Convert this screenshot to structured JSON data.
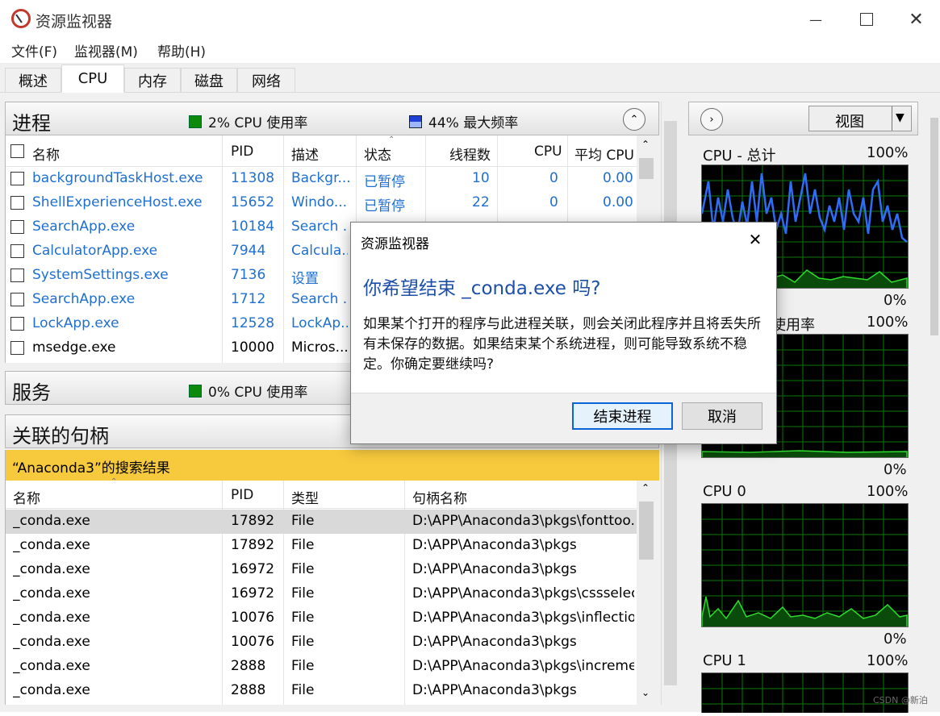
{
  "window": {
    "title": "资源监视器"
  },
  "menu": [
    "文件(F)",
    "监视器(M)",
    "帮助(H)"
  ],
  "tabs": [
    "概述",
    "CPU",
    "内存",
    "磁盘",
    "网络"
  ],
  "active_tab": "CPU",
  "processes": {
    "title": "进程",
    "cpu_usage": "2% CPU 使用率",
    "max_freq": "44% 最大频率",
    "columns": [
      "名称",
      "PID",
      "描述",
      "状态",
      "线程数",
      "CPU",
      "平均 CPU"
    ],
    "rows": [
      {
        "name": "backgroundTaskHost.exe",
        "pid": "11308",
        "desc": "Backgr...",
        "status": "已暂停",
        "threads": "10",
        "cpu": "0",
        "avg": "0.00"
      },
      {
        "name": "ShellExperienceHost.exe",
        "pid": "15652",
        "desc": "Windo...",
        "status": "已暂停",
        "threads": "22",
        "cpu": "0",
        "avg": "0.00"
      },
      {
        "name": "SearchApp.exe",
        "pid": "10184",
        "desc": "Search ..."
      },
      {
        "name": "CalculatorApp.exe",
        "pid": "7944",
        "desc": "Calcula..."
      },
      {
        "name": "SystemSettings.exe",
        "pid": "7136",
        "desc": "设置"
      },
      {
        "name": "SearchApp.exe",
        "pid": "1712",
        "desc": "Search ..."
      },
      {
        "name": "LockApp.exe",
        "pid": "12528",
        "desc": "LockAp..."
      },
      {
        "name": "msedge.exe",
        "pid": "10000",
        "desc": "Micros..."
      }
    ]
  },
  "services": {
    "title": "服务",
    "cpu_usage": "0% CPU 使用率"
  },
  "handles": {
    "title": "关联的句柄",
    "search_result": "“Anaconda3”的搜索结果",
    "columns": [
      "名称",
      "PID",
      "类型",
      "句柄名称"
    ],
    "rows": [
      {
        "name": "_conda.exe",
        "pid": "17892",
        "type": "File",
        "handle": "D:\\APP\\Anaconda3\\pkgs\\fonttoo..."
      },
      {
        "name": "_conda.exe",
        "pid": "17892",
        "type": "File",
        "handle": "D:\\APP\\Anaconda3\\pkgs"
      },
      {
        "name": "_conda.exe",
        "pid": "16972",
        "type": "File",
        "handle": "D:\\APP\\Anaconda3\\pkgs"
      },
      {
        "name": "_conda.exe",
        "pid": "16972",
        "type": "File",
        "handle": "D:\\APP\\Anaconda3\\pkgs\\cssselec..."
      },
      {
        "name": "_conda.exe",
        "pid": "10076",
        "type": "File",
        "handle": "D:\\APP\\Anaconda3\\pkgs\\inflectio..."
      },
      {
        "name": "_conda.exe",
        "pid": "10076",
        "type": "File",
        "handle": "D:\\APP\\Anaconda3\\pkgs"
      },
      {
        "name": "_conda.exe",
        "pid": "2888",
        "type": "File",
        "handle": "D:\\APP\\Anaconda3\\pkgs\\increme..."
      },
      {
        "name": "_conda.exe",
        "pid": "2888",
        "type": "File",
        "handle": "D:\\APP\\Anaconda3\\pkgs"
      }
    ]
  },
  "graphs": {
    "view_label": "视图",
    "items": [
      {
        "label": "CPU - 总计",
        "max": "100%",
        "min": "0%"
      },
      {
        "label": "使用率",
        "max": "100%",
        "min": "0%"
      },
      {
        "label": "CPU 0",
        "max": "100%",
        "min": "0%"
      },
      {
        "label": "CPU 1",
        "max": "100%"
      }
    ]
  },
  "dialog": {
    "title": "资源监视器",
    "heading": "你希望结束 _conda.exe 吗?",
    "body": "如果某个打开的程序与此进程关联，则会关闭此程序并且将丢失所有未保存的数据。如果结束某个系统进程，则可能导致系统不稳定。你确定要继续吗?",
    "confirm": "结束进程",
    "cancel": "取消"
  },
  "watermark": "CSDN @新泊"
}
